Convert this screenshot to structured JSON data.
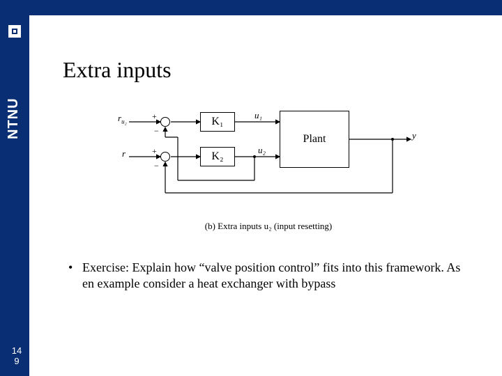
{
  "brand": {
    "name": "NTNU"
  },
  "slide": {
    "title": "Extra inputs",
    "page_a": "14",
    "page_b": "9"
  },
  "diagram": {
    "labels": {
      "ru2": "r",
      "ru2_sub": "u₂",
      "r": "r",
      "K1": "K₁",
      "K2": "K₂",
      "u1": "u₁",
      "u2": "u₂",
      "plant": "Plant",
      "y": "y",
      "plus1": "+",
      "minus1": "−",
      "plus2": "+",
      "minus2": "−"
    },
    "caption": "(b) Extra inputs u₂ (input resetting)"
  },
  "bullet": {
    "text": "Exercise: Explain how “valve position control” fits into this framework. As en example consider a heat exchanger with bypass"
  },
  "chart_data": {
    "type": "diagram",
    "description": "Block diagram: two reference inputs feed two summing junctions with negative feedback. Outputs of summers go to controllers K1 and K2 producing u1 and u2 which enter a Plant block; Plant output y is fed back to both summers. u2 is also fed back as reference r_u2 for the upper loop (input resetting).",
    "blocks": [
      "K1",
      "K2",
      "Plant"
    ],
    "signals": [
      "r_u2",
      "r",
      "u1",
      "u2",
      "y"
    ],
    "summing_junctions": [
      {
        "inputs": [
          "r_u2 (+)",
          "u2 (−)"
        ],
        "output_to": "K1"
      },
      {
        "inputs": [
          "r (+)",
          "y (−)"
        ],
        "output_to": "K2"
      }
    ],
    "connections": [
      "K1 → u1 → Plant",
      "K2 → u2 → Plant",
      "Plant → y",
      "y feedback → summer2 (−)",
      "u2 feedback → summer1 (−)"
    ]
  }
}
